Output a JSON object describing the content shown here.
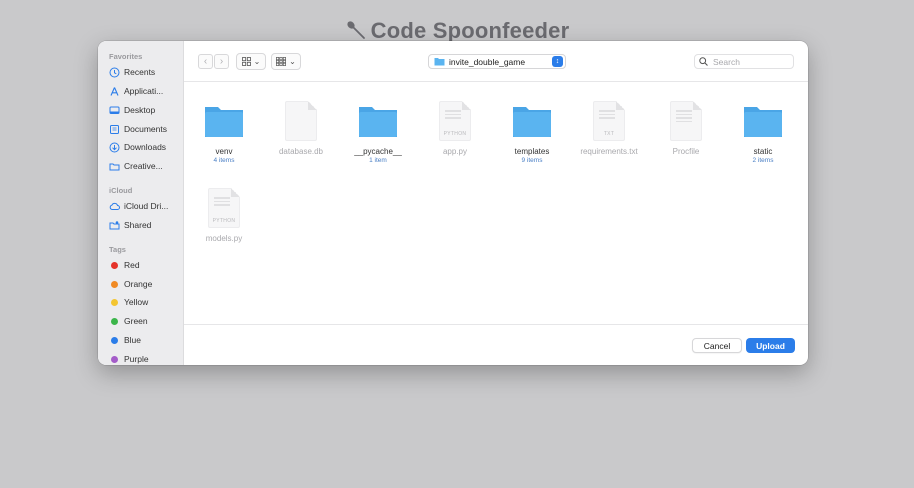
{
  "app": {
    "title": "Code Spoonfeeder"
  },
  "toolbar": {
    "back_icon": "chevron-left-icon",
    "forward_icon": "chevron-right-icon",
    "location": "invite_double_game",
    "search_placeholder": "Search"
  },
  "sidebar": {
    "favorites_header": "Favorites",
    "favorites": [
      {
        "label": "Recents",
        "icon": "clock-icon"
      },
      {
        "label": "Applicati...",
        "icon": "applications-icon"
      },
      {
        "label": "Desktop",
        "icon": "desktop-icon"
      },
      {
        "label": "Documents",
        "icon": "document-icon"
      },
      {
        "label": "Downloads",
        "icon": "download-icon"
      },
      {
        "label": "Creative...",
        "icon": "folder-icon"
      }
    ],
    "icloud_header": "iCloud",
    "icloud": [
      {
        "label": "iCloud Dri...",
        "icon": "cloud-icon"
      },
      {
        "label": "Shared",
        "icon": "shared-folder-icon"
      }
    ],
    "tags_header": "Tags",
    "tags": [
      {
        "label": "Red",
        "color": "#e5332a"
      },
      {
        "label": "Orange",
        "color": "#f08a24"
      },
      {
        "label": "Yellow",
        "color": "#f3c531"
      },
      {
        "label": "Green",
        "color": "#3bb54a"
      },
      {
        "label": "Blue",
        "color": "#2b7de9"
      },
      {
        "label": "Purple",
        "color": "#a45cc9"
      }
    ]
  },
  "files": [
    {
      "name": "venv",
      "sub": "4 items",
      "kind": "folder",
      "enabled": true
    },
    {
      "name": "database.db",
      "sub": "",
      "kind": "doc",
      "tag": "",
      "enabled": false
    },
    {
      "name": "__pycache__",
      "sub": "1 item",
      "kind": "folder",
      "enabled": true
    },
    {
      "name": "app.py",
      "sub": "",
      "kind": "doc",
      "tag": "PYTHON",
      "enabled": false
    },
    {
      "name": "templates",
      "sub": "9 items",
      "kind": "folder",
      "enabled": true
    },
    {
      "name": "requirements.txt",
      "sub": "",
      "kind": "doc",
      "tag": "TXT",
      "enabled": false
    },
    {
      "name": "Procfile",
      "sub": "",
      "kind": "doc",
      "tag": "",
      "enabled": false
    },
    {
      "name": "static",
      "sub": "2 items",
      "kind": "folder",
      "enabled": true
    },
    {
      "name": "models.py",
      "sub": "",
      "kind": "doc",
      "tag": "PYTHON",
      "enabled": false
    }
  ],
  "footer": {
    "cancel_label": "Cancel",
    "upload_label": "Upload"
  },
  "colors": {
    "accent": "#2b7de9",
    "folder": "#5ab4f0"
  }
}
